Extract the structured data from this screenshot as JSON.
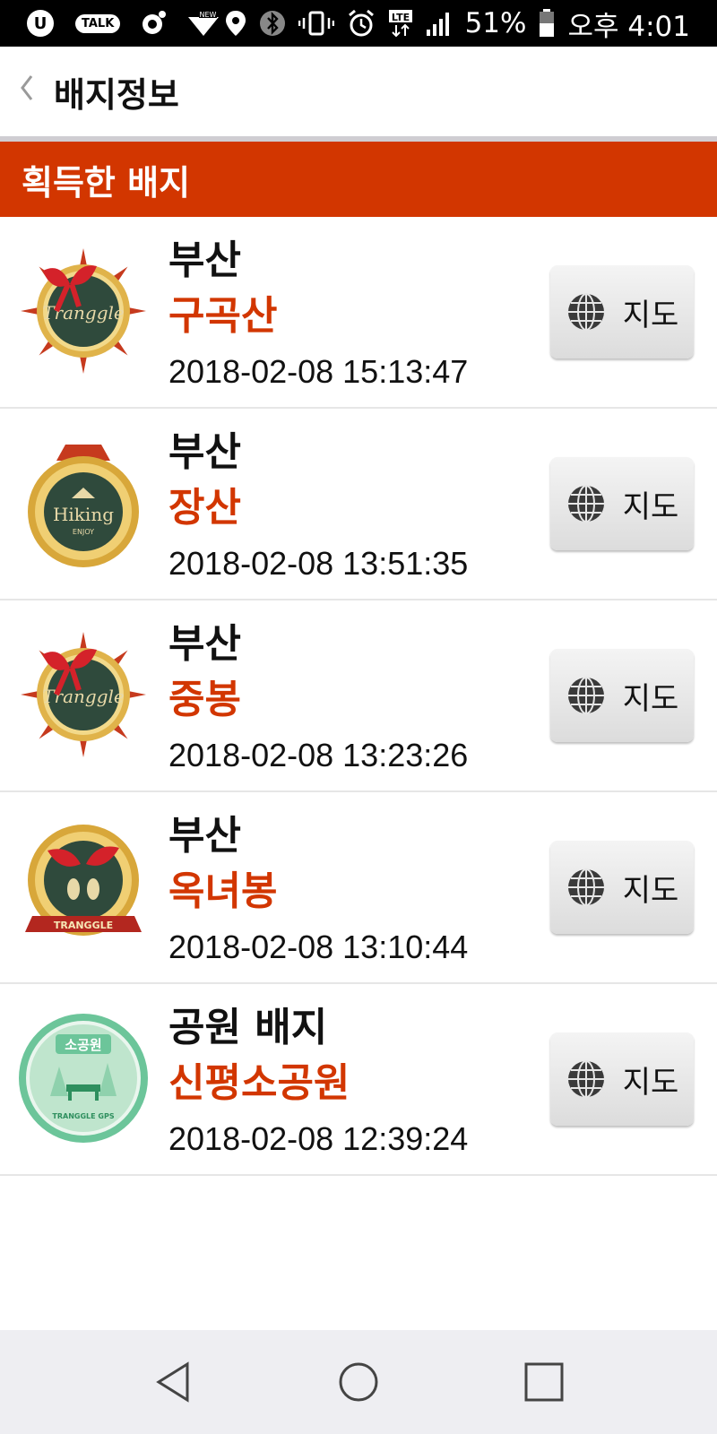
{
  "status_bar": {
    "talk_label": "TALK",
    "battery": "51%",
    "time": "오후 4:01",
    "network": "LTE"
  },
  "header": {
    "title": "배지정보",
    "back_icon": "chevron-left-icon"
  },
  "section": {
    "title": "획득한 배지"
  },
  "badges": [
    {
      "region": "부산",
      "name": "구곡산",
      "datetime": "2018-02-08 15:13:47",
      "badge_text": "Tranggle",
      "map_label": "지도"
    },
    {
      "region": "부산",
      "name": "장산",
      "datetime": "2018-02-08 13:51:35",
      "badge_text": "Hiking",
      "badge_subtext": "ENJOY",
      "map_label": "지도"
    },
    {
      "region": "부산",
      "name": "중봉",
      "datetime": "2018-02-08 13:23:26",
      "badge_text": "Tranggle",
      "map_label": "지도"
    },
    {
      "region": "부산",
      "name": "옥녀봉",
      "datetime": "2018-02-08 13:10:44",
      "badge_text": "TRANGGLE",
      "map_label": "지도"
    },
    {
      "region": "공원 배지",
      "name": "신평소공원",
      "datetime": "2018-02-08 12:39:24",
      "badge_text": "소공원",
      "badge_subtext": "TRANGGLE GPS",
      "map_label": "지도"
    }
  ],
  "colors": {
    "accent": "#d23600",
    "badge_green": "#2f4a3c",
    "badge_gold": "#d8a73a",
    "park_green": "#6cc59a"
  }
}
